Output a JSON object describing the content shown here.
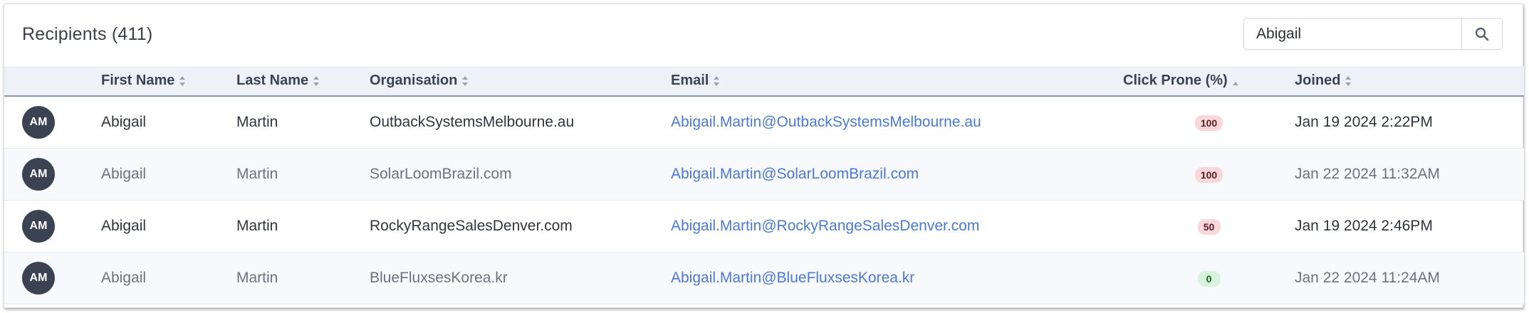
{
  "header": {
    "title": "Recipients (411)"
  },
  "search": {
    "value": "Abigail"
  },
  "table": {
    "columns": [
      {
        "key": "avatar",
        "label": ""
      },
      {
        "key": "first_name",
        "label": "First Name"
      },
      {
        "key": "last_name",
        "label": "Last Name"
      },
      {
        "key": "organisation",
        "label": "Organisation"
      },
      {
        "key": "email",
        "label": "Email"
      },
      {
        "key": "click_prone",
        "label": "Click Prone (%)"
      },
      {
        "key": "joined",
        "label": "Joined"
      }
    ],
    "rows": [
      {
        "initials": "AM",
        "first_name": "Abigail",
        "last_name": "Martin",
        "organisation": "OutbackSystemsMelbourne.au",
        "email": "Abigail.Martin@OutbackSystemsMelbourne.au",
        "click_prone": "100",
        "joined": "Jan 19 2024 2:22PM"
      },
      {
        "initials": "AM",
        "first_name": "Abigail",
        "last_name": "Martin",
        "organisation": "SolarLoomBrazil.com",
        "email": "Abigail.Martin@SolarLoomBrazil.com",
        "click_prone": "100",
        "joined": "Jan 22 2024 11:32AM"
      },
      {
        "initials": "AM",
        "first_name": "Abigail",
        "last_name": "Martin",
        "organisation": "RockyRangeSalesDenver.com",
        "email": "Abigail.Martin@RockyRangeSalesDenver.com",
        "click_prone": "50",
        "joined": "Jan 19 2024 2:46PM"
      },
      {
        "initials": "AM",
        "first_name": "Abigail",
        "last_name": "Martin",
        "organisation": "BlueFluxsesKorea.kr",
        "email": "Abigail.Martin@BlueFluxsesKorea.kr",
        "click_prone": "0",
        "joined": "Jan 22 2024 11:24AM"
      }
    ]
  },
  "colors": {
    "avatar_bg": "#3b4353",
    "link": "#4a79d6",
    "badge_high_bg": "#fad7da",
    "badge_low_bg": "#d7f3dc",
    "header_bg": "#eef2f8"
  }
}
